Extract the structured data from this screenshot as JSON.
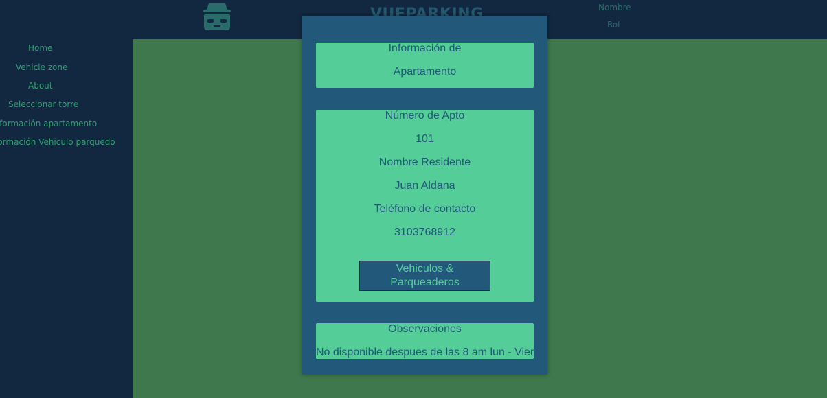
{
  "header": {
    "brand": "VUEPARKING",
    "logo_icon": "incognito-car-icon",
    "user_name": "Nombre",
    "user_role": "Rol"
  },
  "sidebar": {
    "items": [
      {
        "label": "Home"
      },
      {
        "label": "Vehicle zone"
      },
      {
        "label": "About"
      },
      {
        "label": "Seleccionar torre"
      },
      {
        "label": "Información apartamento"
      },
      {
        "label": "Información Vehiculo parquedo"
      }
    ]
  },
  "modal": {
    "title_line1": "Información de",
    "title_line2": "Apartamento",
    "apt_number_label": "Número de Apto",
    "apt_number": "101",
    "resident_label": "Nombre Residente",
    "resident_name": "Juan Aldana",
    "phone_label": "Teléfono de contacto",
    "phone": "3103768912",
    "vehicles_button_line1": "Vehiculos &",
    "vehicles_button_line2": "Parqueaderos",
    "observations_label": "Observaciones",
    "observations_text": "No disponible despues de las 8 am lun - Vier"
  },
  "colors": {
    "background": "#122740",
    "main": "#3f784d",
    "modal": "#22587a",
    "card": "#54cd98",
    "sidebar_text": "#2aa06e"
  }
}
